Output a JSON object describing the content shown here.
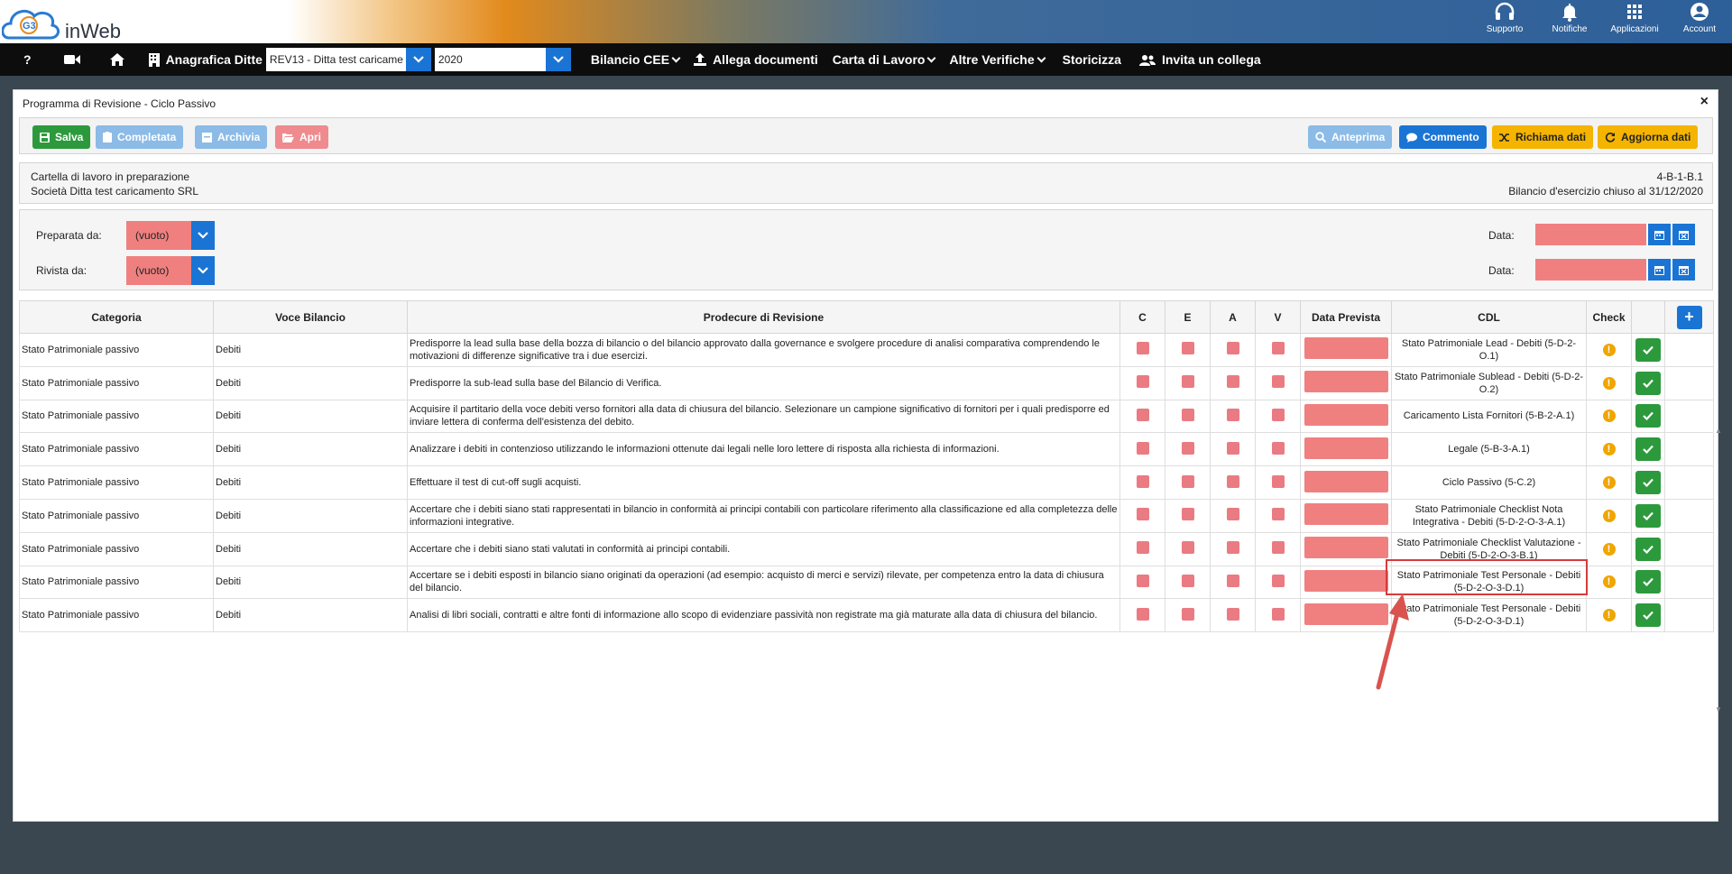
{
  "header": {
    "logo_text": "inWeb",
    "logo_letters": "G3",
    "icons": [
      {
        "label": "Supporto",
        "icon": "headset-icon"
      },
      {
        "label": "Notifiche",
        "icon": "bell-icon"
      },
      {
        "label": "Applicazioni",
        "icon": "grid-icon"
      },
      {
        "label": "Account",
        "icon": "user-icon"
      }
    ]
  },
  "nav": {
    "help": "?",
    "anagrafica_label": "Anagrafica Ditte",
    "company_select": "REV13 - Ditta test caricame",
    "year_select": "2020",
    "bilancio_cee": "Bilancio CEE",
    "allega": "Allega documenti",
    "carta": "Carta di Lavoro",
    "altre": "Altre Verifiche",
    "storicizza": "Storicizza",
    "invita": "Invita un collega"
  },
  "panel": {
    "title": "Programma di Revisione - Ciclo Passivo",
    "close": "×"
  },
  "toolbar": {
    "salva": "Salva",
    "completata": "Completata",
    "archivia": "Archivia",
    "apri": "Apri",
    "anteprima": "Anteprima",
    "commento": "Commento",
    "richiama": "Richiama dati",
    "aggiorna": "Aggiorna dati",
    "colors": {
      "green": "#2c9a3c",
      "lightblue": "#8bbbe6",
      "pink": "#ef8a8e",
      "blue": "#1a74d4",
      "yellow": "#f4b400"
    }
  },
  "info": {
    "line1": "Cartella di lavoro in preparazione",
    "line2": "Società Ditta test caricamento SRL",
    "code": "4-B-1-B.1",
    "bilancio": "Bilancio d'esercizio chiuso al 31/12/2020"
  },
  "form": {
    "preparata_label": "Preparata da:",
    "preparata_value": "(vuoto)",
    "rivista_label": "Rivista da:",
    "rivista_value": "(vuoto)",
    "data_label": "Data:"
  },
  "table": {
    "headers": {
      "categoria": "Categoria",
      "voce": "Voce Bilancio",
      "procedure": "Prodecure di Revisione",
      "c": "C",
      "e": "E",
      "a": "A",
      "v": "V",
      "data_prevista": "Data Prevista",
      "cdl": "CDL",
      "check": "Check"
    },
    "rows": [
      {
        "categoria": "Stato Patrimoniale passivo",
        "voce": "Debiti",
        "procedura": "Predisporre la lead sulla base della bozza di bilancio o del bilancio approvato dalla governance e svolgere procedure di analisi comparativa comprendendo le motivazioni di differenze significative tra i due esercizi.",
        "cdl": "Stato Patrimoniale Lead - Debiti (5-D-2-O.1)"
      },
      {
        "categoria": "Stato Patrimoniale passivo",
        "voce": "Debiti",
        "procedura": "Predisporre la sub-lead sulla base del Bilancio di Verifica.",
        "cdl": "Stato Patrimoniale Sublead - Debiti (5-D-2-O.2)"
      },
      {
        "categoria": "Stato Patrimoniale passivo",
        "voce": "Debiti",
        "procedura": "Acquisire il partitario della voce debiti verso fornitori alla data di chiusura del bilancio. Selezionare un campione significativo di fornitori per i quali predisporre ed inviare lettera di conferma dell'esistenza del debito.",
        "cdl": "Caricamento Lista Fornitori (5-B-2-A.1)"
      },
      {
        "categoria": "Stato Patrimoniale passivo",
        "voce": "Debiti",
        "procedura": "Analizzare i debiti in contenzioso utilizzando le informazioni ottenute dai legali nelle loro lettere di risposta alla richiesta di informazioni.",
        "cdl": "Legale (5-B-3-A.1)"
      },
      {
        "categoria": "Stato Patrimoniale passivo",
        "voce": "Debiti",
        "procedura": "Effettuare il test di cut-off sugli acquisti.",
        "cdl": "Ciclo Passivo (5-C.2)"
      },
      {
        "categoria": "Stato Patrimoniale passivo",
        "voce": "Debiti",
        "procedura": "Accertare che i debiti siano stati rappresentati in bilancio in conformità ai principi contabili con particolare riferimento alla classificazione ed alla completezza delle informazioni integrative.",
        "cdl": "Stato Patrimoniale Checklist Nota Integrativa - Debiti (5-D-2-O-3-A.1)"
      },
      {
        "categoria": "Stato Patrimoniale passivo",
        "voce": "Debiti",
        "procedura": "Accertare che i debiti siano stati valutati in conformità ai principi contabili.",
        "cdl": "Stato Patrimoniale Checklist Valutazione - Debiti (5-D-2-O-3-B.1)"
      },
      {
        "categoria": "Stato Patrimoniale passivo",
        "voce": "Debiti",
        "procedura": "Accertare se i debiti esposti in bilancio siano originati da operazioni (ad esempio: acquisto di merci e servizi) rilevate, per competenza entro la data di chiusura del bilancio.",
        "cdl": "Stato Patrimoniale Test Personale - Debiti (5-D-2-O-3-D.1)"
      },
      {
        "categoria": "Stato Patrimoniale passivo",
        "voce": "Debiti",
        "procedura": "Analisi di libri sociali, contratti e altre fonti di informazione allo scopo di evidenziare passività non registrate ma già maturate alla data di chiusura del bilancio.",
        "cdl": "Stato Patrimoniale Test Personale - Debiti (5-D-2-O-3-D.1)"
      }
    ]
  }
}
